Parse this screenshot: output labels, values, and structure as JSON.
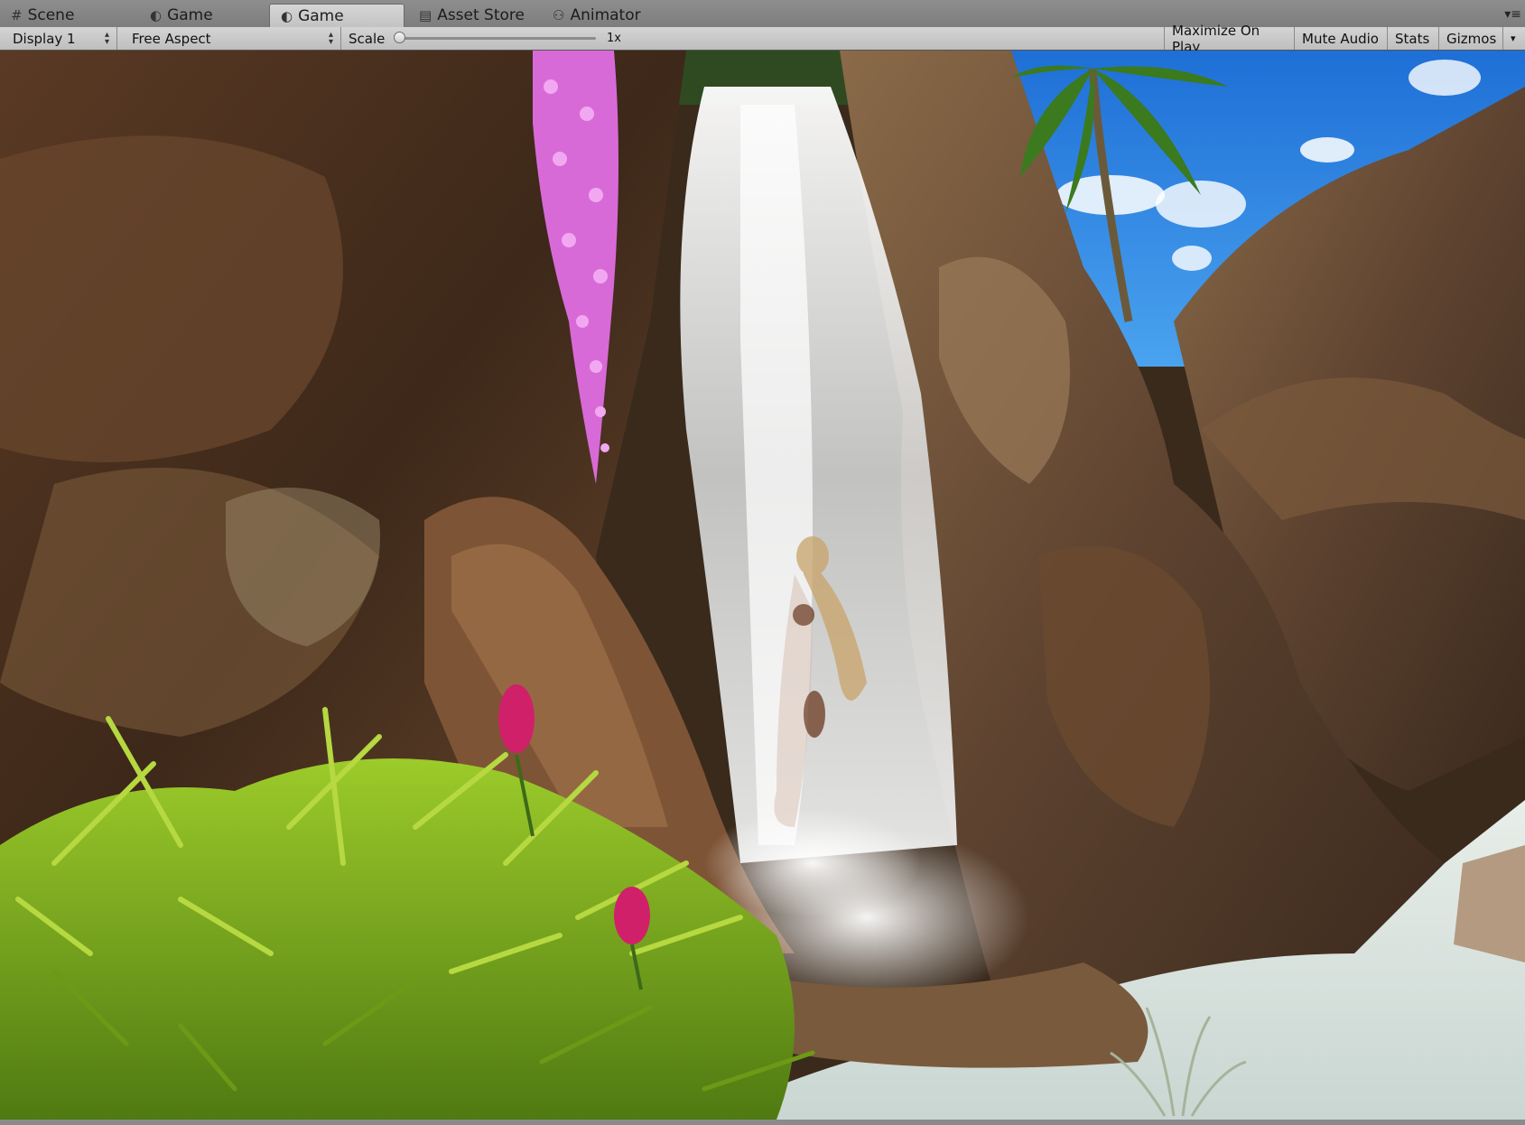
{
  "tabs": [
    {
      "label": "Scene",
      "icon": "grid-icon",
      "active": false
    },
    {
      "label": "Game",
      "icon": "game-controller-icon",
      "active": false
    },
    {
      "label": "Game",
      "icon": "game-controller-icon",
      "active": true
    },
    {
      "label": "Asset Store",
      "icon": "store-bag-icon",
      "active": false
    },
    {
      "label": "Animator",
      "icon": "animator-icon",
      "active": false
    }
  ],
  "toolbar": {
    "display": "Display 1",
    "aspect": "Free Aspect",
    "scale_label": "Scale",
    "scale_value": "1x",
    "scale_fraction": 0.0,
    "maximize_on_play": "Maximize On Play",
    "mute_audio": "Mute Audio",
    "stats": "Stats",
    "gizmos": "Gizmos"
  },
  "scene": {
    "description_icons": [
      "waterfall",
      "palm-tree",
      "rocks",
      "bamboo-bush",
      "pink-flowers",
      "character"
    ]
  }
}
